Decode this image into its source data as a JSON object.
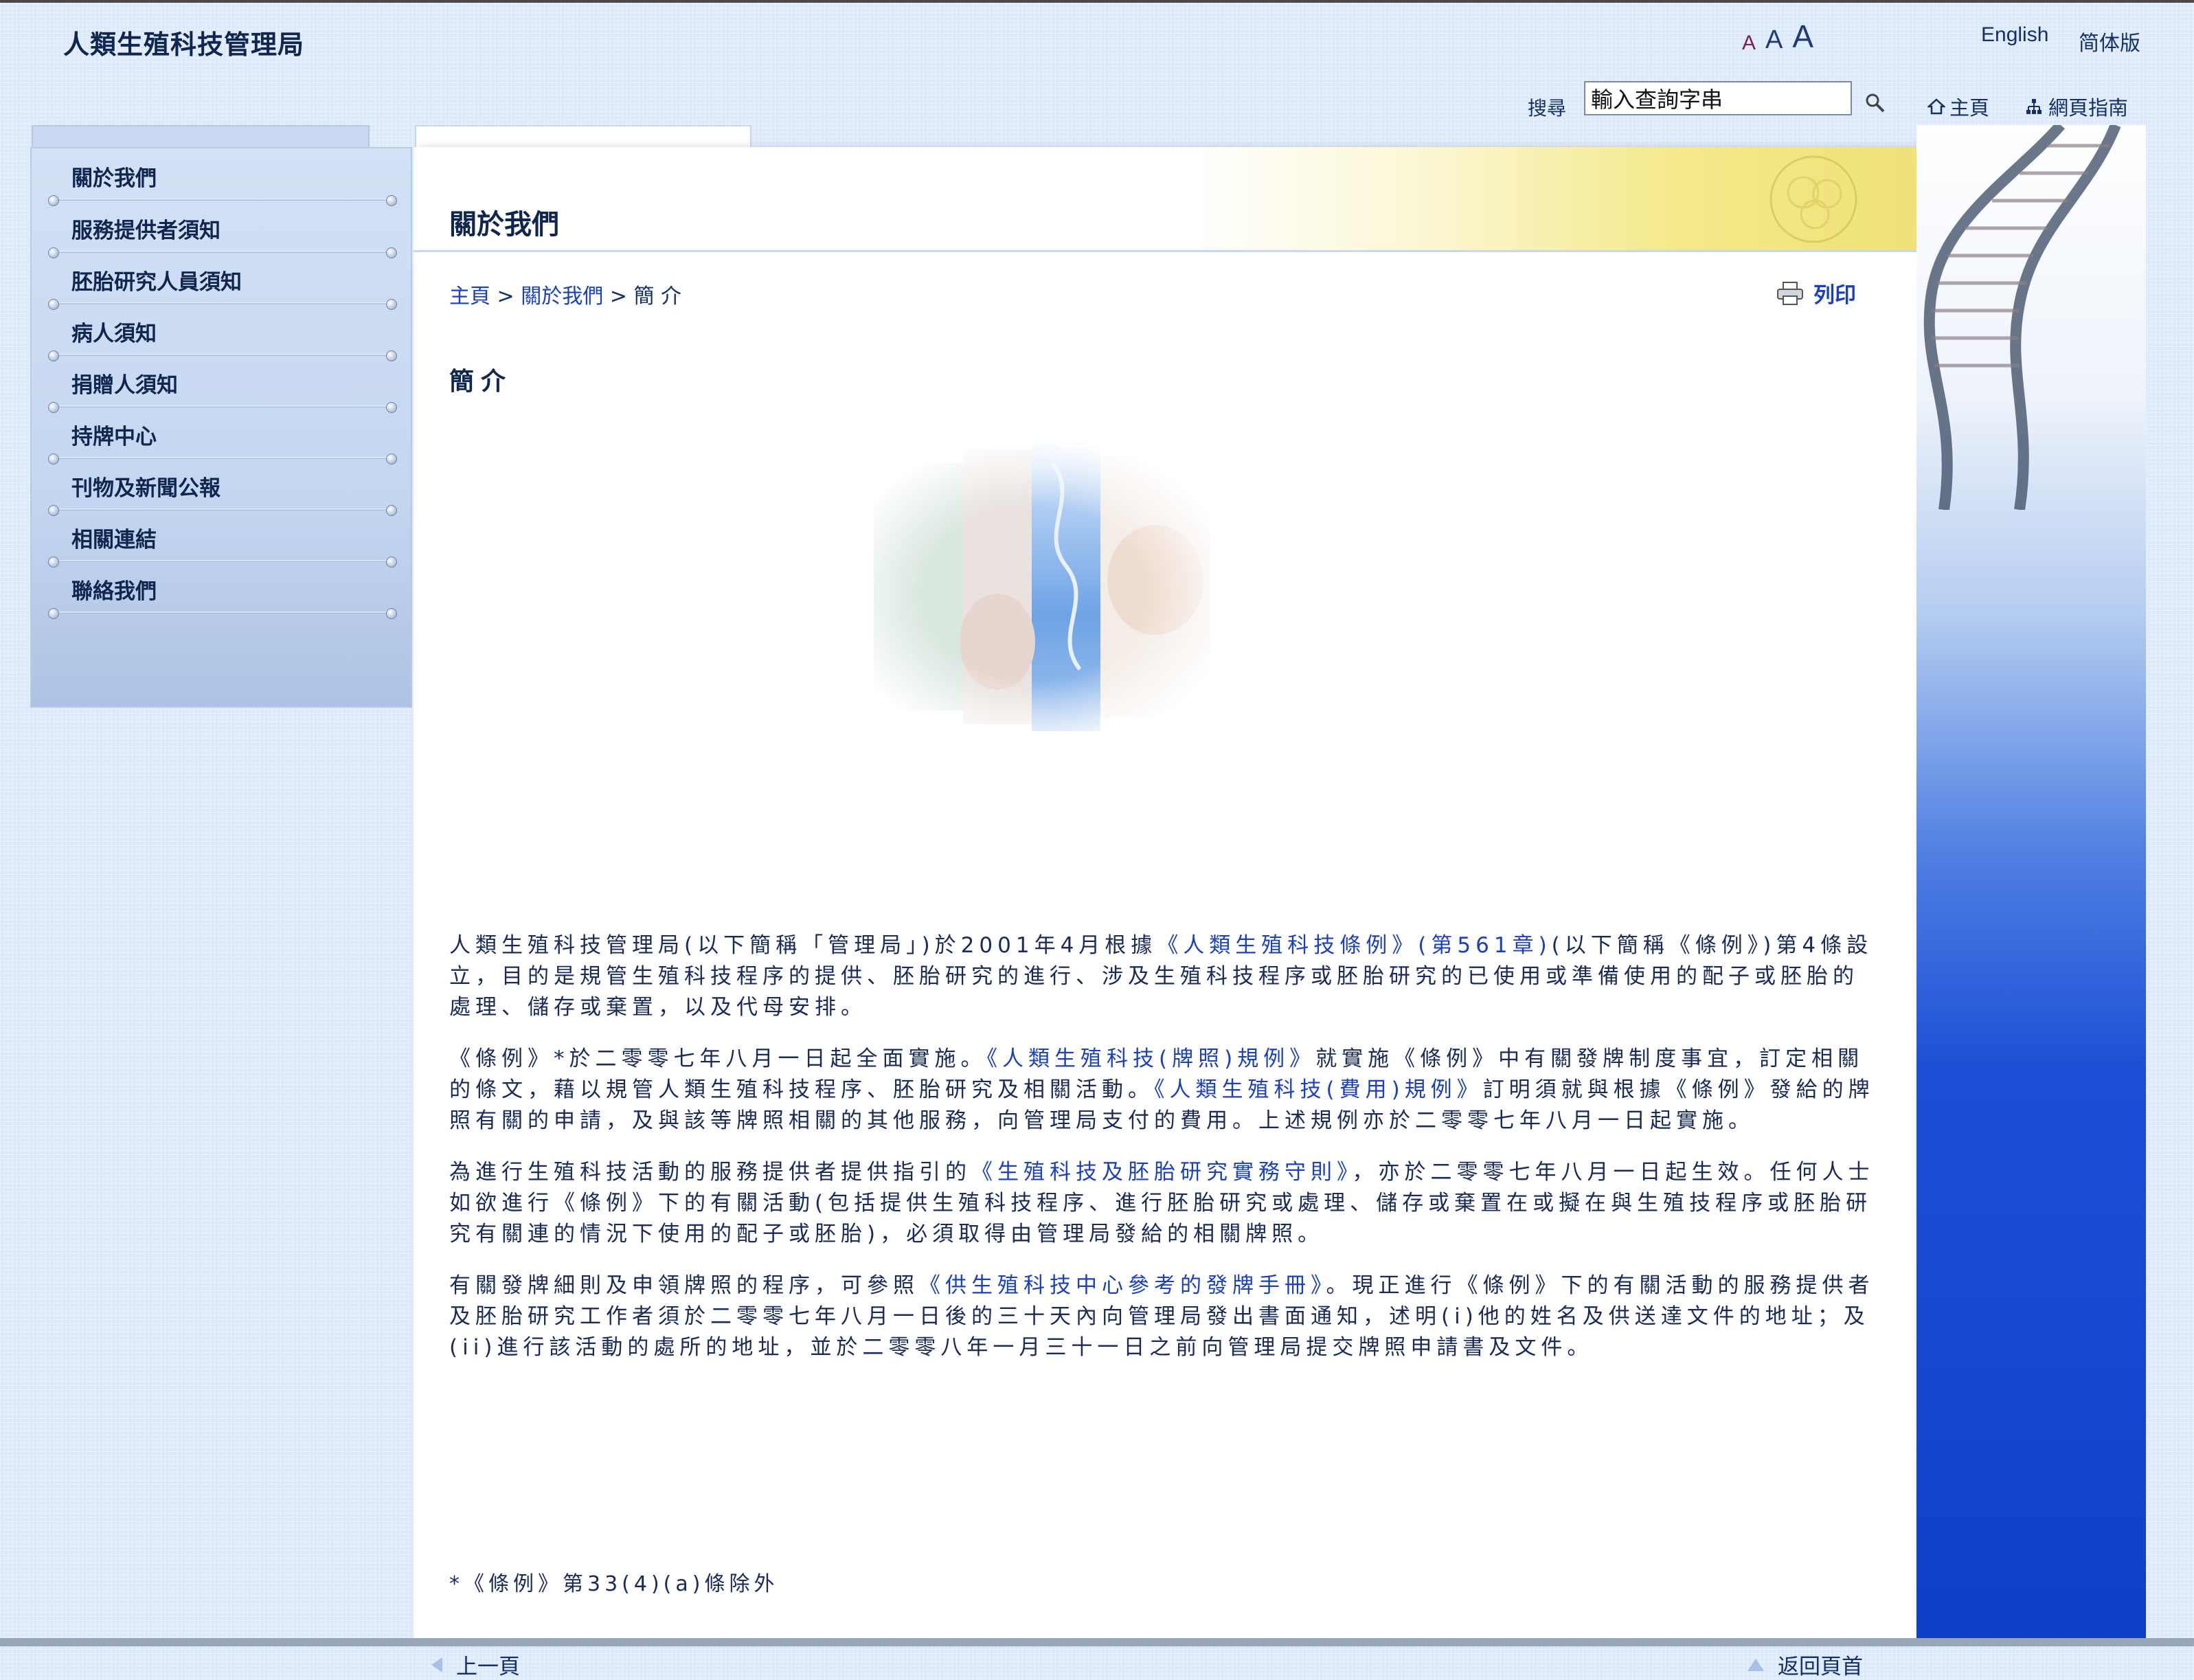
{
  "header": {
    "site_title": "人類生殖科技管理局",
    "font_size_small": "A",
    "font_size_medium": "A",
    "font_size_large": "A",
    "lang_english": "English",
    "lang_simplified": "简体版",
    "search_label": "搜尋",
    "search_placeholder": "輸入查詢字串",
    "home": "主頁",
    "sitemap": "網頁指南"
  },
  "sidebar": {
    "items": [
      {
        "label": "關於我們"
      },
      {
        "label": "服務提供者須知"
      },
      {
        "label": "胚胎研究人員須知"
      },
      {
        "label": "病人須知"
      },
      {
        "label": "捐贈人須知"
      },
      {
        "label": "持牌中心"
      },
      {
        "label": "刊物及新聞公報"
      },
      {
        "label": "相關連結"
      },
      {
        "label": "聯絡我們"
      }
    ]
  },
  "main": {
    "heading": "關於我們",
    "breadcrumb": {
      "home": "主頁",
      "sep1": " > ",
      "about": "關於我們",
      "sep2": " > ",
      "current": "簡 介"
    },
    "print": "列印",
    "section_title": "簡介",
    "paragraphs": {
      "p1_a": "人類生殖科技管理局(以下簡稱「管理局」)於2001年4月根據",
      "p1_link": "《人類生殖科技條例》(第561章)",
      "p1_b": "(以下簡稱《條例》)第4條設立，目的是規管生殖科技程序的提供、胚胎研究的進行、涉及生殖科技程序或胚胎研究的已使用或準備使用的配子或胚胎的處理、儲存或棄置，以及代母安排。",
      "p2_a": "《條例》*於二零零七年八月一日起全面實施。",
      "p2_link1": "《人類生殖科技(牌照)規例》",
      "p2_b": "就實施《條例》中有關發牌制度事宜，訂定相關的條文，藉以規管人類生殖科技程序、胚胎研究及相關活動。",
      "p2_link2": "《人類生殖科技(費用)規例》",
      "p2_c": "訂明須就與根據《條例》發給的牌照有關的申請，及與該等牌照相關的其他服務，向管理局支付的費用。上述規例亦於二零零七年八月一日起實施。",
      "p3_a": "為進行生殖科技活動的服務提供者提供指引的",
      "p3_link": "《生殖科技及胚胎研究實務守則》",
      "p3_b": "，亦於二零零七年八月一日起生效。任何人士如欲進行《條例》下的有關活動(包括提供生殖科技程序、進行胚胎研究或處理、儲存或棄置在或擬在與生殖技程序或胚胎研究有關連的情況下使用的配子或胚胎)，必須取得由管理局發給的相關牌照。",
      "p4_a": "有關發牌細則及申領牌照的程序，可參照",
      "p4_link": "《供生殖科技中心參考的發牌手冊》",
      "p4_b": "。現正進行《條例》下的有關活動的服務提供者及胚胎研究工作者須於二零零七年八月一日後的三十天內向管理局發出書面通知，述明(i)他的姓名及供送達文件的地址；及(ii)進行該活動的處所的地址，並於二零零八年一月三十一日之前向管理局提交牌照申請書及文件。"
    },
    "footnote": "*《條例》第33(4)(a)條除外",
    "prev_page": "上一頁",
    "back_to_top": "返回頁首"
  },
  "colors": {
    "link": "#1a3fbf",
    "text": "#1a2a5a",
    "background": "#dce9fa",
    "accent_strip": "#1d4fd6"
  }
}
